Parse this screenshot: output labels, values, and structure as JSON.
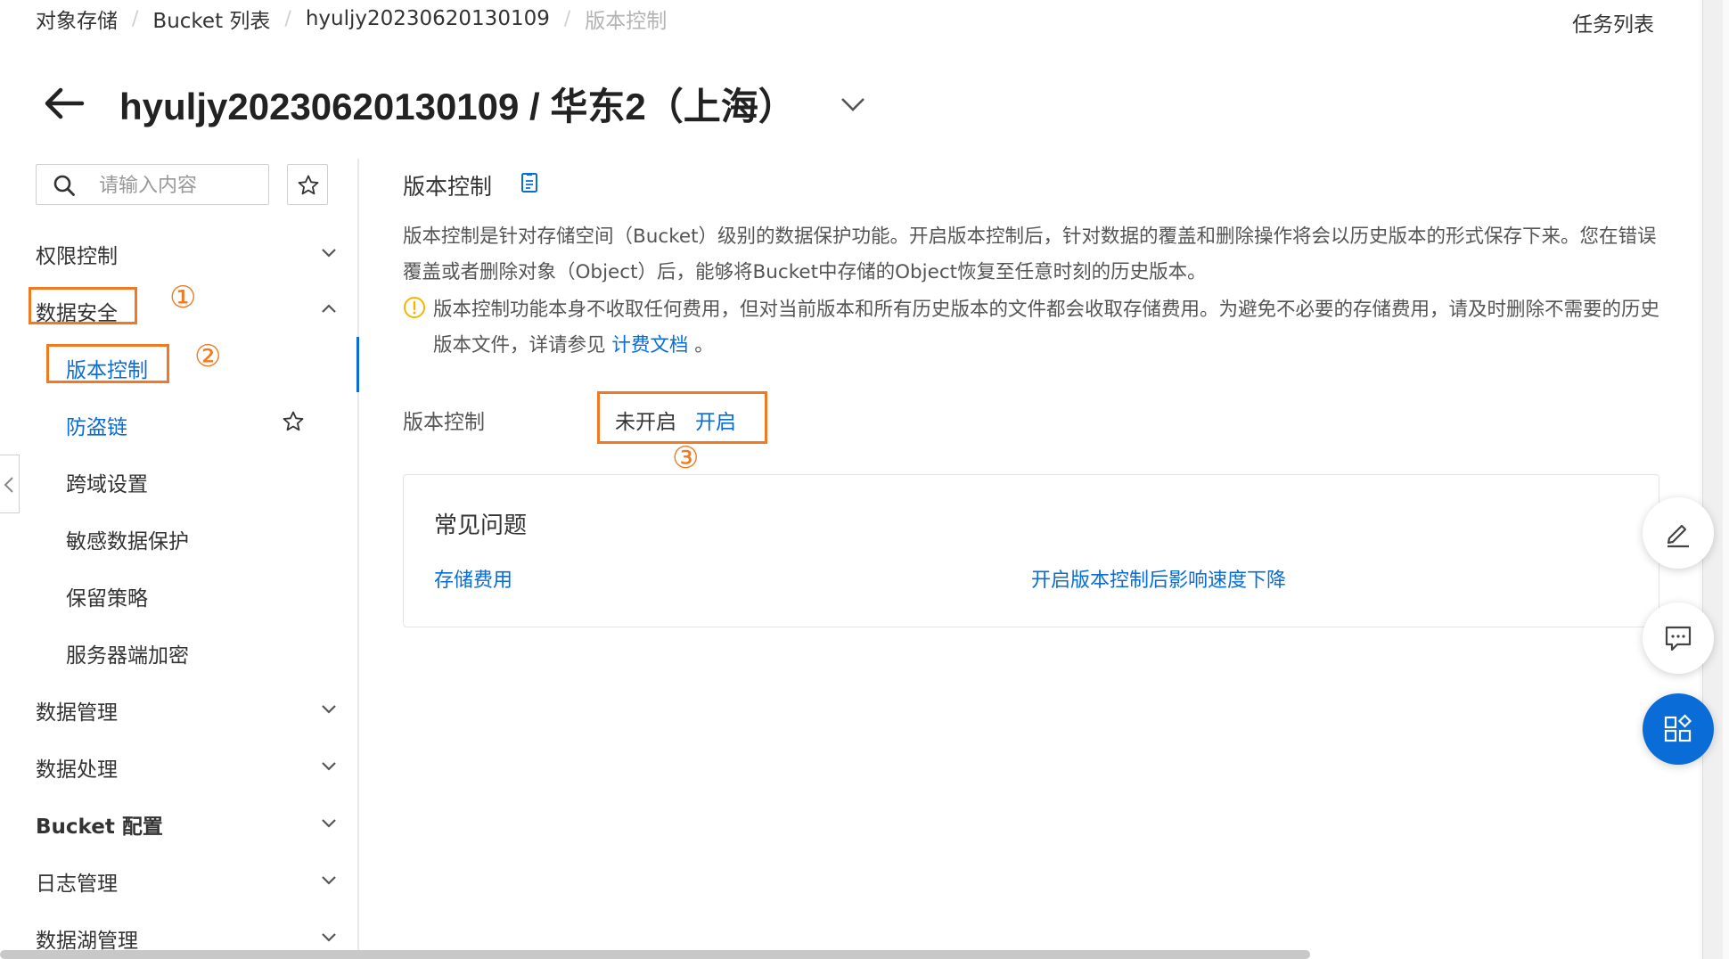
{
  "breadcrumb": {
    "items": [
      "对象存储",
      "Bucket 列表",
      "hyuljy20230620130109",
      "版本控制"
    ],
    "separator": "/"
  },
  "header": {
    "task_list": "任务列表",
    "title": "hyuljy20230620130109 / 华东2（上海）"
  },
  "sidebar": {
    "search_placeholder": "请输入内容",
    "items": [
      {
        "label": "权限控制"
      },
      {
        "label": "数据安全"
      },
      {
        "label": "数据管理"
      },
      {
        "label": "数据处理"
      },
      {
        "label": "Bucket 配置"
      },
      {
        "label": "日志管理"
      },
      {
        "label": "数据湖管理"
      }
    ],
    "sub_items": [
      {
        "label": "版本控制"
      },
      {
        "label": "防盗链"
      },
      {
        "label": "跨域设置"
      },
      {
        "label": "敏感数据保护"
      },
      {
        "label": "保留策略"
      },
      {
        "label": "服务器端加密"
      }
    ]
  },
  "markers": [
    "①",
    "②",
    "③"
  ],
  "main": {
    "section_title": "版本控制",
    "description": "版本控制是针对存储空间（Bucket）级别的数据保护功能。开启版本控制后，针对数据的覆盖和删除操作将会以历史版本的形式保存下来。您在错误覆盖或者删除对象（Object）后，能够将Bucket中存储的Object恢复至任意时刻的历史版本。",
    "warning_text": "版本控制功能本身不收取任何费用，但对当前版本和所有历史版本的文件都会收取存储费用。为避免不必要的存储费用，请及时删除不需要的历史版本文件，详请参见",
    "warning_link": "计费文档",
    "warning_end": "。",
    "vc_label": "版本控制",
    "vc_status": "未开启",
    "vc_action": "开启"
  },
  "faq": {
    "title": "常见问题",
    "links": [
      "存储费用",
      "开启版本控制后影响速度下降"
    ]
  },
  "colors": {
    "accent": "#0a6cd6",
    "highlight": "#f07a21"
  }
}
